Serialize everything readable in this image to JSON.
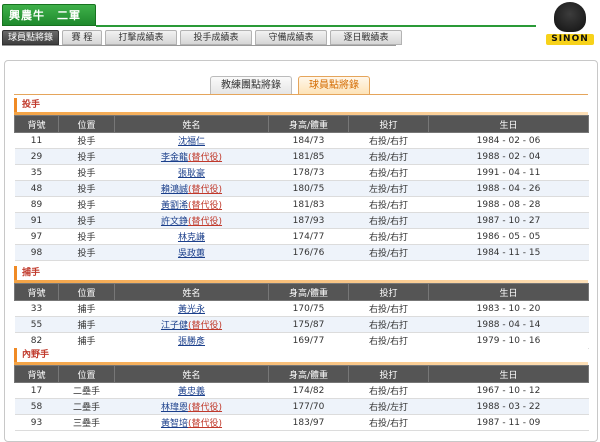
{
  "header": {
    "team_title": "興農牛　二軍",
    "logo_text": "SINON"
  },
  "nav": {
    "items": [
      {
        "label": "球員點將錄",
        "active": true
      },
      {
        "label": "賽 程",
        "active": false
      },
      {
        "label": "打擊成績表",
        "active": false
      },
      {
        "label": "投手成績表",
        "active": false
      },
      {
        "label": "守備成績表",
        "active": false
      },
      {
        "label": "逐日戰績表",
        "active": false
      }
    ]
  },
  "subtabs": [
    {
      "label": "教練團點將錄",
      "active": false
    },
    {
      "label": "球員點將錄",
      "active": true
    }
  ],
  "columns": [
    "背號",
    "位置",
    "姓名",
    "身高/體重",
    "投打",
    "生日"
  ],
  "sections": [
    {
      "title": "投手",
      "rows": [
        {
          "number": "11",
          "position": "投手",
          "name": "沈福仁",
          "sub": "",
          "hw": "184/73",
          "bt": "右投/右打",
          "birth": "1984 - 02 - 06"
        },
        {
          "number": "29",
          "position": "投手",
          "name": "李金龍",
          "sub": "(替代役)",
          "hw": "181/85",
          "bt": "右投/右打",
          "birth": "1988 - 02 - 04"
        },
        {
          "number": "35",
          "position": "投手",
          "name": "張耿豪",
          "sub": "",
          "hw": "178/73",
          "bt": "右投/右打",
          "birth": "1991 - 04 - 11"
        },
        {
          "number": "48",
          "position": "投手",
          "name": "賴鴻誠",
          "sub": "(替代役)",
          "hw": "180/75",
          "bt": "左投/右打",
          "birth": "1988 - 04 - 26"
        },
        {
          "number": "89",
          "position": "投手",
          "name": "黃劉浠",
          "sub": "(替代役)",
          "hw": "181/83",
          "bt": "右投/右打",
          "birth": "1988 - 08 - 28"
        },
        {
          "number": "91",
          "position": "投手",
          "name": "許文錚",
          "sub": "(替代役)",
          "hw": "187/93",
          "bt": "右投/右打",
          "birth": "1987 - 10 - 27"
        },
        {
          "number": "97",
          "position": "投手",
          "name": "林克謙",
          "sub": "",
          "hw": "174/77",
          "bt": "右投/右打",
          "birth": "1986 - 05 - 05"
        },
        {
          "number": "98",
          "position": "投手",
          "name": "吳政蕙",
          "sub": "",
          "hw": "176/76",
          "bt": "右投/右打",
          "birth": "1984 - 11 - 15"
        }
      ]
    },
    {
      "title": "捕手",
      "rows": [
        {
          "number": "33",
          "position": "捕手",
          "name": "黃光永",
          "sub": "",
          "hw": "170/75",
          "bt": "右投/右打",
          "birth": "1983 - 10 - 20"
        },
        {
          "number": "55",
          "position": "捕手",
          "name": "江子健",
          "sub": "(替代役)",
          "hw": "175/87",
          "bt": "右投/右打",
          "birth": "1988 - 04 - 14"
        },
        {
          "number": "82",
          "position": "捕手",
          "name": "張勝彥",
          "sub": "",
          "hw": "169/77",
          "bt": "右投/右打",
          "birth": "1979 - 10 - 16"
        }
      ]
    },
    {
      "title": "內野手",
      "rows": [
        {
          "number": "17",
          "position": "二壘手",
          "name": "黃忠義",
          "sub": "",
          "hw": "174/82",
          "bt": "右投/右打",
          "birth": "1967 - 10 - 12"
        },
        {
          "number": "58",
          "position": "二壘手",
          "name": "林瑋恩",
          "sub": "(替代役)",
          "hw": "177/70",
          "bt": "右投/左打",
          "birth": "1988 - 03 - 22"
        },
        {
          "number": "93",
          "position": "三壘手",
          "name": "黃智培",
          "sub": "(替代役)",
          "hw": "183/97",
          "bt": "右投/右打",
          "birth": "1987 - 11 - 09"
        }
      ]
    }
  ]
}
